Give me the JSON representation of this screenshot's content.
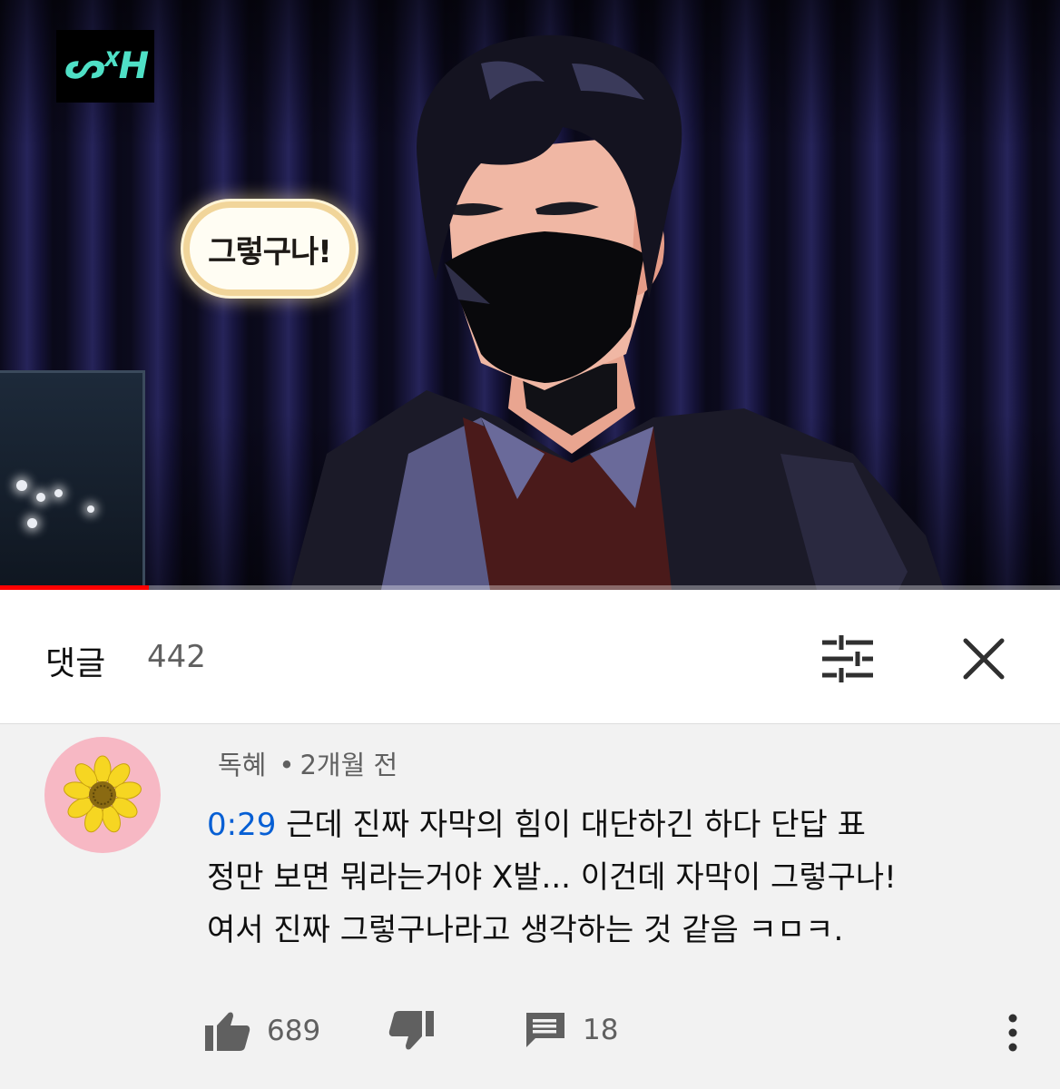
{
  "video": {
    "channel_logo_text": "ᔕᕽᕼ",
    "caption_bubble": "그렇구나!",
    "progress_fraction": 0.14,
    "colors": {
      "progress": "#ff0000",
      "background": "#0e0c22"
    }
  },
  "comments_panel": {
    "title": "댓글",
    "count": "442",
    "sort_icon": "sort-icon",
    "close_icon": "close-icon"
  },
  "comment": {
    "author": "독혜",
    "separator": "•",
    "age": "2개월 전",
    "timestamp": "0:29",
    "lines": [
      " 근데 진짜 자막의 힘이 대단하긴 하다  단답  표",
      "정만 보면 뭐라는거야 X발... 이건데 자막이 그렇구나!",
      "여서 진짜 그렇구나라고 생각하는 것 같음 ㅋㅁㅋ."
    ],
    "avatar_icon": "sunflower-icon",
    "likes": "689",
    "replies": "18",
    "colors": {
      "link": "#065fd4",
      "avatar_bg": "#f7b8c4"
    }
  }
}
